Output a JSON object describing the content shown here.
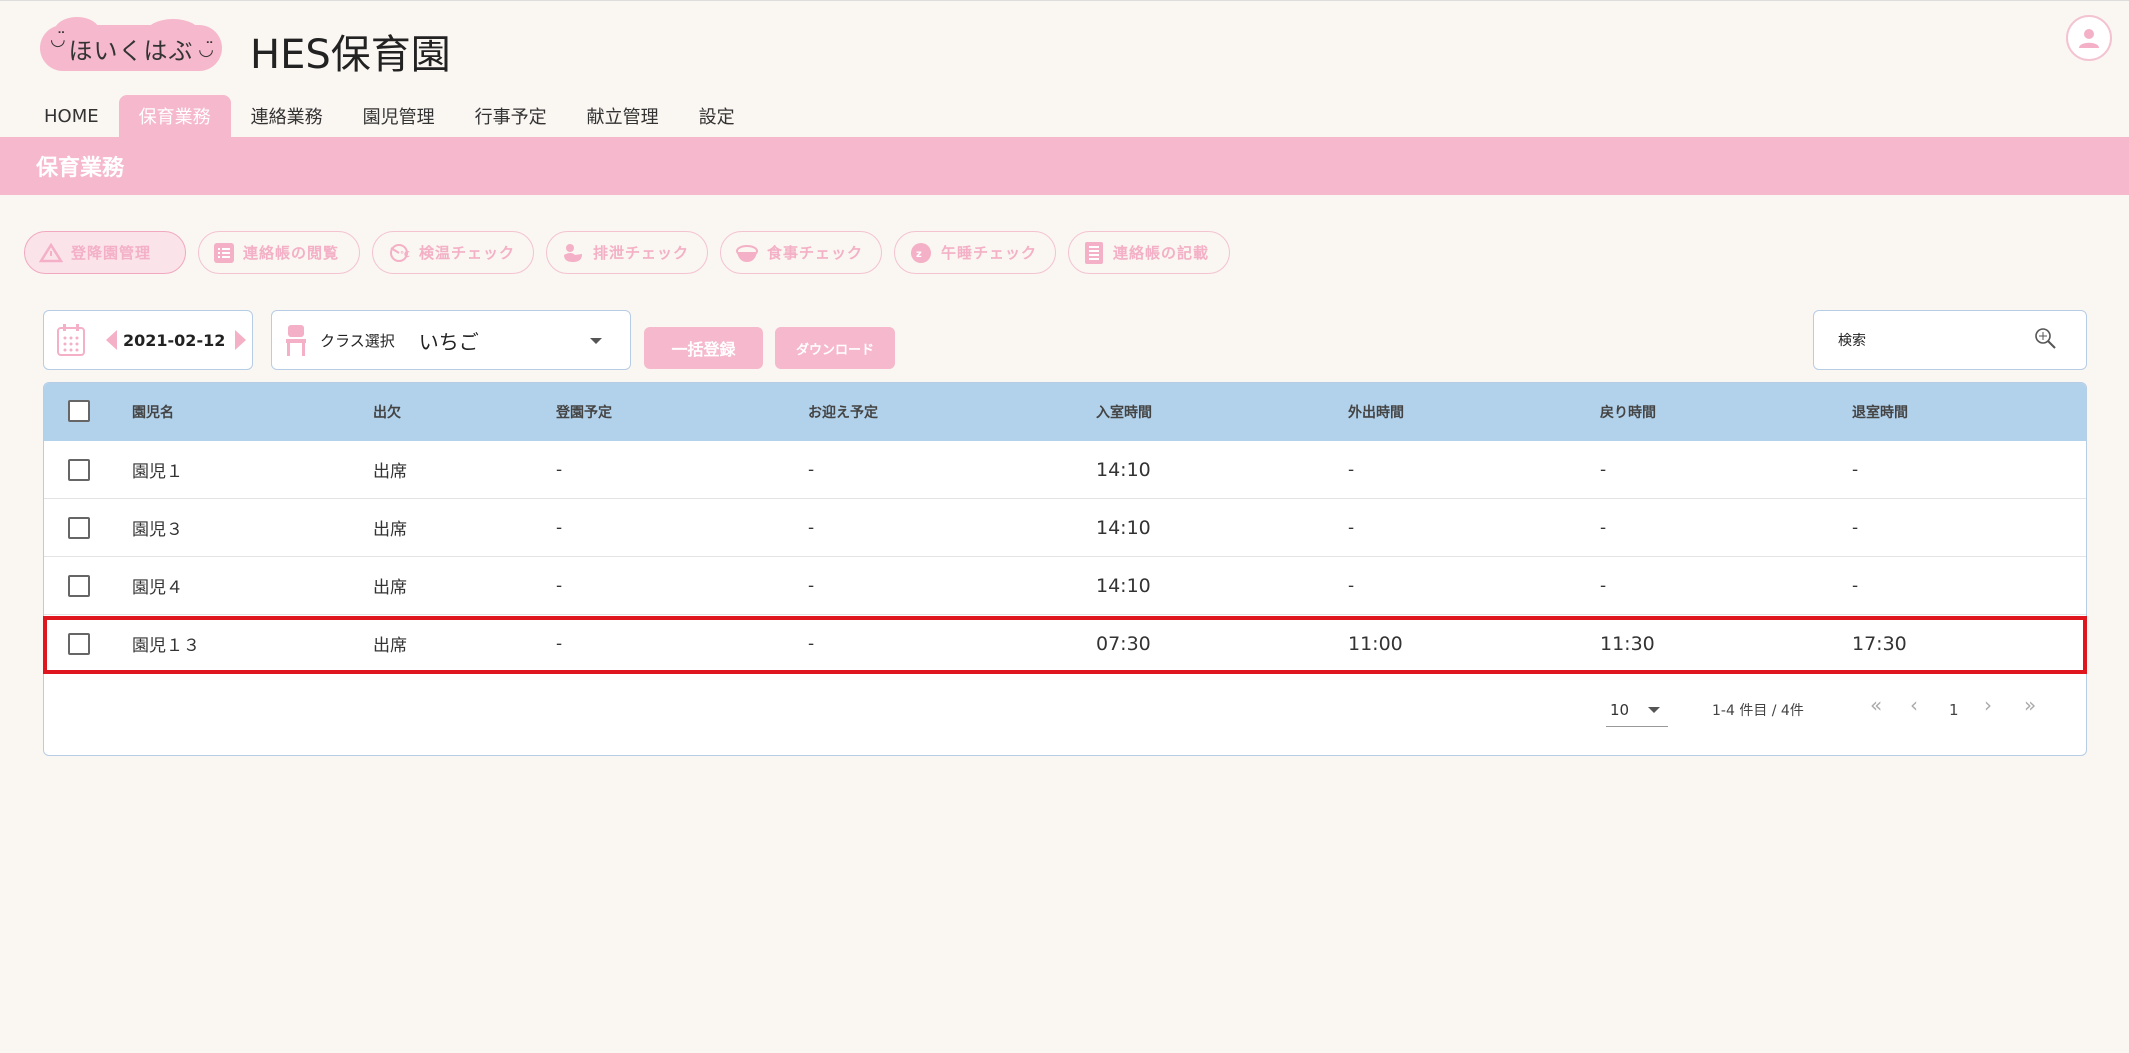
{
  "header": {
    "logo_text": "ほいくはぶ",
    "logo_face_left": "◡̈",
    "logo_face_right": "◡̈",
    "app_title": "HES保育園"
  },
  "nav": {
    "items": [
      {
        "label": "HOME",
        "active": false
      },
      {
        "label": "保育業務",
        "active": true
      },
      {
        "label": "連絡業務",
        "active": false
      },
      {
        "label": "園児管理",
        "active": false
      },
      {
        "label": "行事予定",
        "active": false
      },
      {
        "label": "献立管理",
        "active": false
      },
      {
        "label": "設定",
        "active": false
      }
    ]
  },
  "section": {
    "title": "保育業務"
  },
  "functions": [
    {
      "label": "登降園管理",
      "icon": "warning-triangle-icon",
      "active": true
    },
    {
      "label": "連絡帳の閲覧",
      "icon": "list-icon",
      "active": false
    },
    {
      "label": "検温チェック",
      "icon": "thermometer-icon",
      "active": false
    },
    {
      "label": "排泄チェック",
      "icon": "duck-icon",
      "active": false
    },
    {
      "label": "食事チェック",
      "icon": "bowl-icon",
      "active": false
    },
    {
      "label": "午睡チェック",
      "icon": "sleep-icon",
      "active": false
    },
    {
      "label": "連絡帳の記載",
      "icon": "notebook-icon",
      "active": false
    }
  ],
  "controls": {
    "date": "2021-02-12",
    "class_label": "クラス選択",
    "class_value": "いちご",
    "bulk_button": "一括登録",
    "download_button": "ダウンロード",
    "search_placeholder": "検索"
  },
  "table": {
    "columns": [
      "園児名",
      "出欠",
      "登園予定",
      "お迎え予定",
      "入室時間",
      "外出時間",
      "戻り時間",
      "退室時間"
    ],
    "rows": [
      {
        "name": "園児１",
        "attendance": "出席",
        "arrival_plan": "-",
        "pickup_plan": "-",
        "in_time": "14:10",
        "out_time": "-",
        "return_time": "-",
        "leave_time": "-"
      },
      {
        "name": "園児３",
        "attendance": "出席",
        "arrival_plan": "-",
        "pickup_plan": "-",
        "in_time": "14:10",
        "out_time": "-",
        "return_time": "-",
        "leave_time": "-"
      },
      {
        "name": "園児４",
        "attendance": "出席",
        "arrival_plan": "-",
        "pickup_plan": "-",
        "in_time": "14:10",
        "out_time": "-",
        "return_time": "-",
        "leave_time": "-"
      },
      {
        "name": "園児１３",
        "attendance": "出席",
        "arrival_plan": "-",
        "pickup_plan": "-",
        "in_time": "07:30",
        "out_time": "11:00",
        "return_time": "11:30",
        "leave_time": "17:30"
      }
    ]
  },
  "pagination": {
    "per_page": "10",
    "range": "1-4 件目 / 4件",
    "first": "«",
    "prev": "‹",
    "page": "1",
    "next": "›",
    "last": "»"
  },
  "colors": {
    "accent_pink": "#f5b8cc",
    "table_header_blue": "#b2d1eb",
    "highlight_red": "#e0161f",
    "background": "#faf6f2"
  }
}
